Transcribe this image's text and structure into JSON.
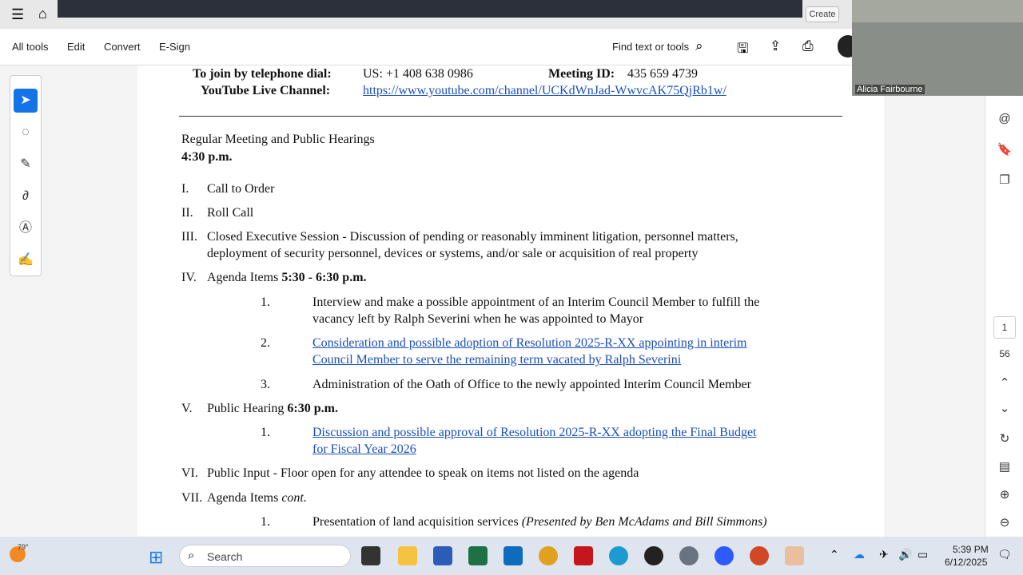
{
  "toolbar": {
    "create": "Create",
    "menu": [
      "All tools",
      "Edit",
      "Convert",
      "E-Sign"
    ],
    "find": "Find text or tools"
  },
  "video": {
    "name": "Alicia Fairbourne"
  },
  "doc": {
    "phone_label": "To join by telephone dial:",
    "phone": "US: +1 408 638 0986",
    "meeting_label": "Meeting ID:",
    "meeting_id": "435 659 4739",
    "yt_label": "YouTube Live Channel:",
    "yt_link": "https://www.youtube.com/channel/UCKdWnJad-WwvcAK75QjRb1w/",
    "heading": "Regular Meeting and Public Hearings",
    "time": "4:30 p.m.",
    "items": [
      {
        "num": "I.",
        "text": "Call to Order"
      },
      {
        "num": "II.",
        "text": "Roll Call"
      },
      {
        "num": "III.",
        "text": "Closed Executive Session - Discussion of pending or reasonably imminent litigation, personnel matters,",
        "text2": "deployment of security personnel, devices or systems, and/or sale or acquisition of real property"
      },
      {
        "num": "IV.",
        "text": "Agenda Items ",
        "bold": "5:30 - 6:30 p.m."
      },
      {
        "num": "V.",
        "text": "Public Hearing ",
        "bold": "6:30 p.m."
      },
      {
        "num": "VI.",
        "text": "Public Input - Floor open for any attendee to speak on items not listed on the agenda"
      },
      {
        "num": "VII.",
        "text": "Agenda Items ",
        "ital": "cont."
      }
    ],
    "sub": [
      {
        "num": "1.",
        "l1": "Interview and make a possible appointment of an Interim Council Member to fulfill the",
        "l2": "vacancy left by Ralph Severini when he was appointed to Mayor"
      },
      {
        "num": "2.",
        "l1": "Consideration and possible adoption of Resolution 2025-R-XX appointing in interim",
        "l2": "Council Member to serve the remaining term vacated by Ralph Severini"
      },
      {
        "num": "3.",
        "l1": "Administration of the Oath of Office to the newly appointed Interim Council Member"
      },
      {
        "num": "1.",
        "l1": "Discussion and possible approval of Resolution 2025-R-XX adopting the Final Budget",
        "l2": "for Fiscal Year 2026"
      },
      {
        "num": "1.",
        "l1": "Presentation of land acquisition services ",
        "ital": "(Presented by Ben McAdams and Bill Simmons)"
      }
    ]
  },
  "pager": {
    "current": "1",
    "total": "56"
  },
  "taskbar": {
    "weather": "79°",
    "search": "Search",
    "time": "5:39 PM",
    "date": "6/12/2025"
  }
}
